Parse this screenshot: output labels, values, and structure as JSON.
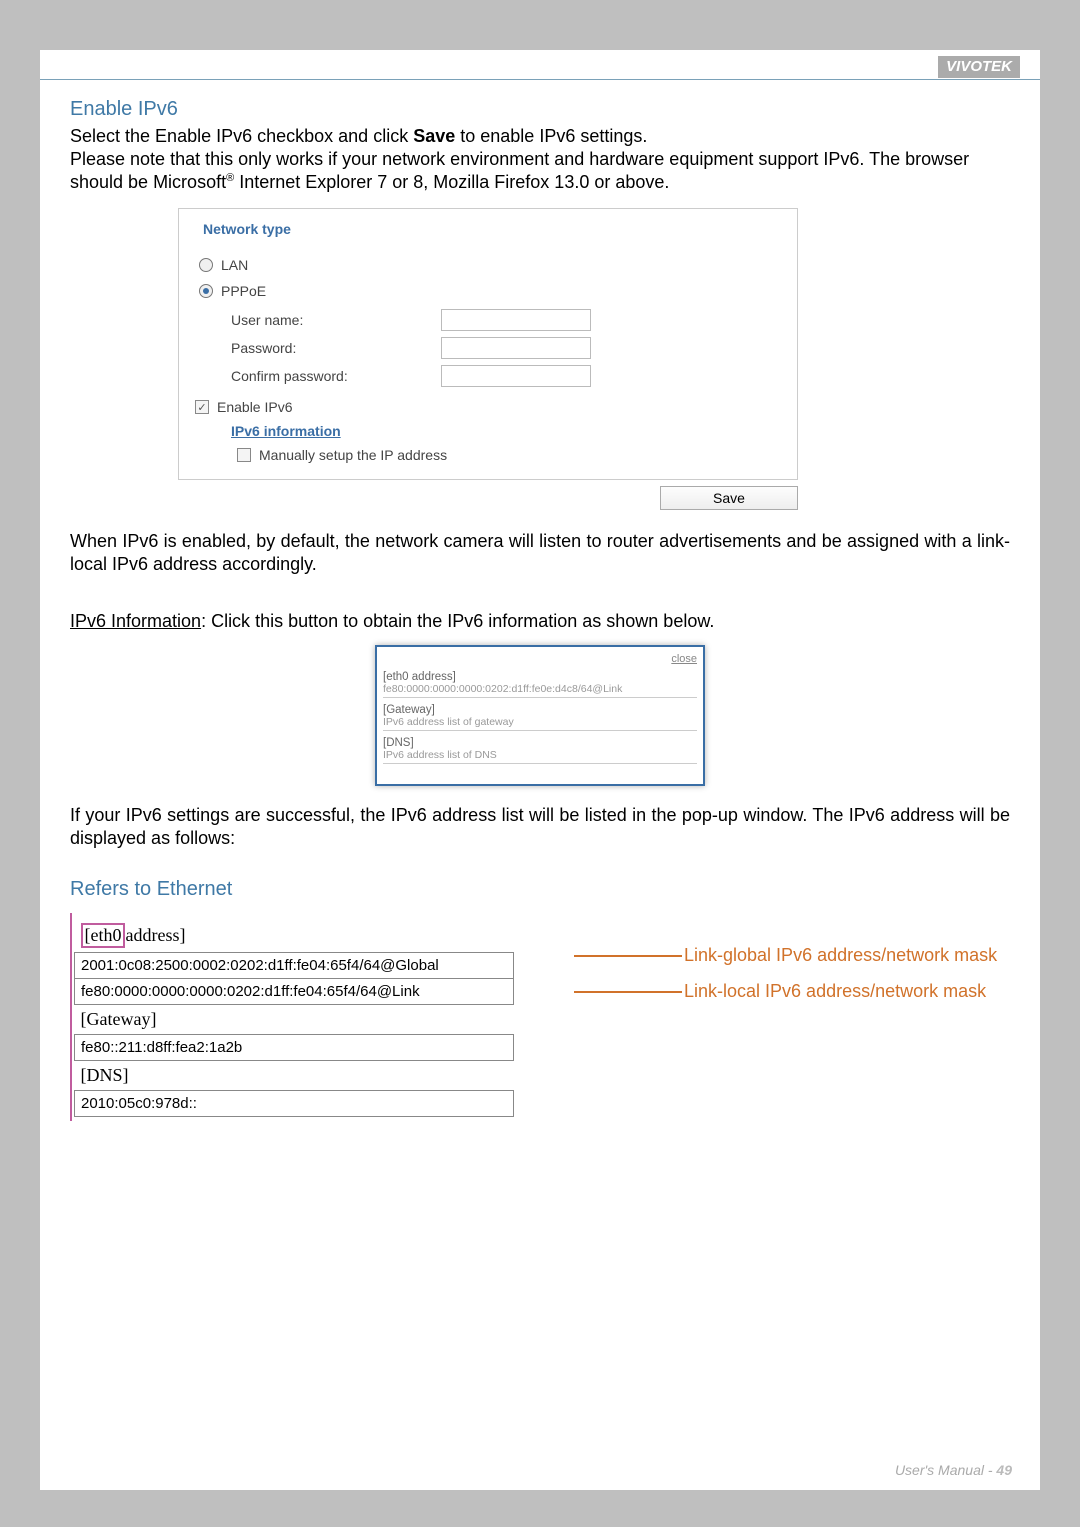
{
  "header": {
    "brand": "VIVOTEK"
  },
  "section1": {
    "title": "Enable IPv6",
    "p1a": "Select the Enable IPv6 checkbox and click ",
    "p1b": "Save",
    "p1c": " to enable IPv6 settings.",
    "p2": "Please note that this only works if your network environment and hardware equipment support IPv6. The browser should be Microsoft",
    "p2b": " Internet Explorer 7 or 8, Mozilla Firefox 13.0 or above.",
    "reg": "®"
  },
  "panel": {
    "legend": "Network type",
    "lan": "LAN",
    "pppoe": "PPPoE",
    "user": "User name:",
    "pass": "Password:",
    "conf": "Confirm password:",
    "enable": "Enable IPv6",
    "info": "IPv6 information",
    "manual": "Manually setup the IP address",
    "save": "Save"
  },
  "mid": {
    "p3": "When IPv6 is enabled, by default, the network camera will listen to router advertisements and be assigned with a link-local IPv6 address accordingly.",
    "p4a": "IPv6 Information",
    "p4b": ": Click this button to obtain the IPv6 information as shown below."
  },
  "popup": {
    "close": "close",
    "eth": "[eth0 address]",
    "ethv": "fe80:0000:0000:0000:0202:d1ff:fe0e:d4c8/64@Link",
    "gw": "[Gateway]",
    "gwv": "IPv6 address list of gateway",
    "dns": "[DNS]",
    "dnsv": "IPv6 address list of DNS"
  },
  "post": {
    "p5": "If your IPv6 settings are successful, the IPv6 address list will be listed in the pop-up window. The IPv6 address will be displayed as follows:",
    "title": "Refers to Ethernet"
  },
  "eth": {
    "h_eth_a": "[eth0",
    "h_eth_b": "address]",
    "r1": "2001:0c08:2500:0002:0202:d1ff:fe04:65f4/64@Global",
    "r2": "fe80:0000:0000:0000:0202:d1ff:fe04:65f4/64@Link",
    "gw": "[Gateway]",
    "gwv": "fe80::211:d8ff:fea2:1a2b",
    "dns": "[DNS]",
    "dnsv": "2010:05c0:978d::",
    "ann1": "Link-global IPv6 address/network mask",
    "ann2": "Link-local IPv6 address/network mask"
  },
  "footer": {
    "a": "User's Manual - ",
    "b": "49"
  }
}
